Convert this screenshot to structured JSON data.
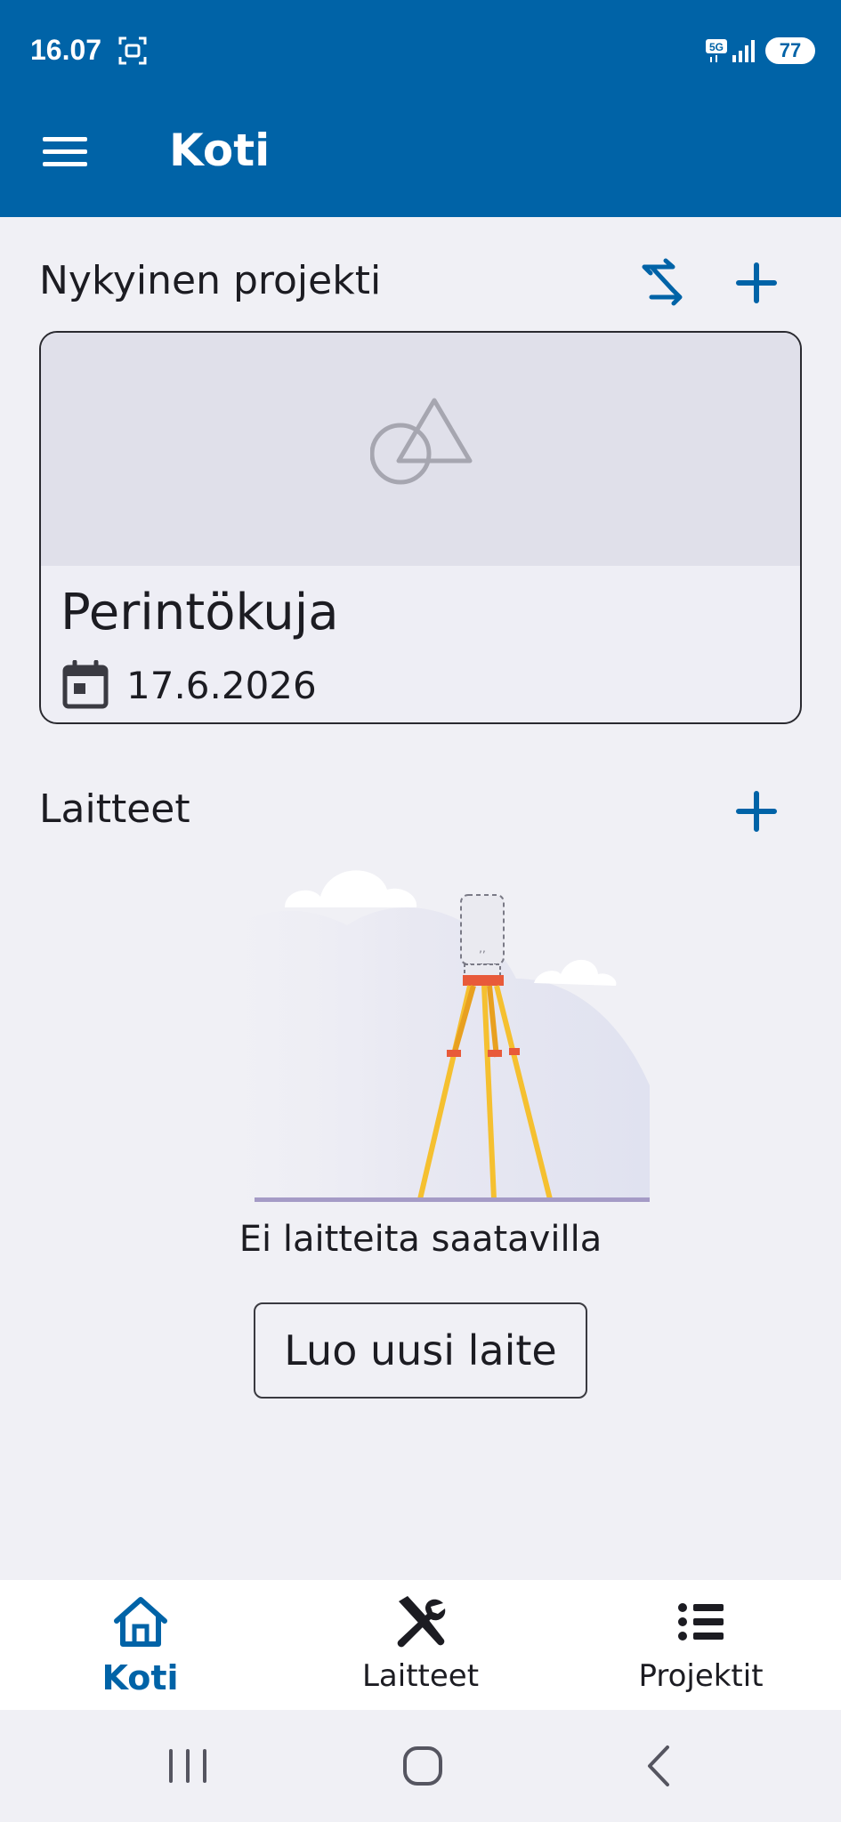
{
  "status_bar": {
    "time": "16.07",
    "network": "5G",
    "battery": "77"
  },
  "app_bar": {
    "title": "Koti"
  },
  "current_project": {
    "section_title": "Nykyinen projekti",
    "project_name": "Perintökuja",
    "project_date": "17.6.2026"
  },
  "devices": {
    "section_title": "Laitteet",
    "empty_text": "Ei laitteita saatavilla",
    "create_button": "Luo uusi laite"
  },
  "bottom_nav": {
    "items": [
      {
        "label": "Koti",
        "icon": "home-icon",
        "active": true
      },
      {
        "label": "Laitteet",
        "icon": "tools-icon",
        "active": false
      },
      {
        "label": "Projektit",
        "icon": "list-icon",
        "active": false
      }
    ]
  },
  "colors": {
    "primary": "#0063a7",
    "background": "#f0f0f5",
    "text": "#1c1c22"
  }
}
